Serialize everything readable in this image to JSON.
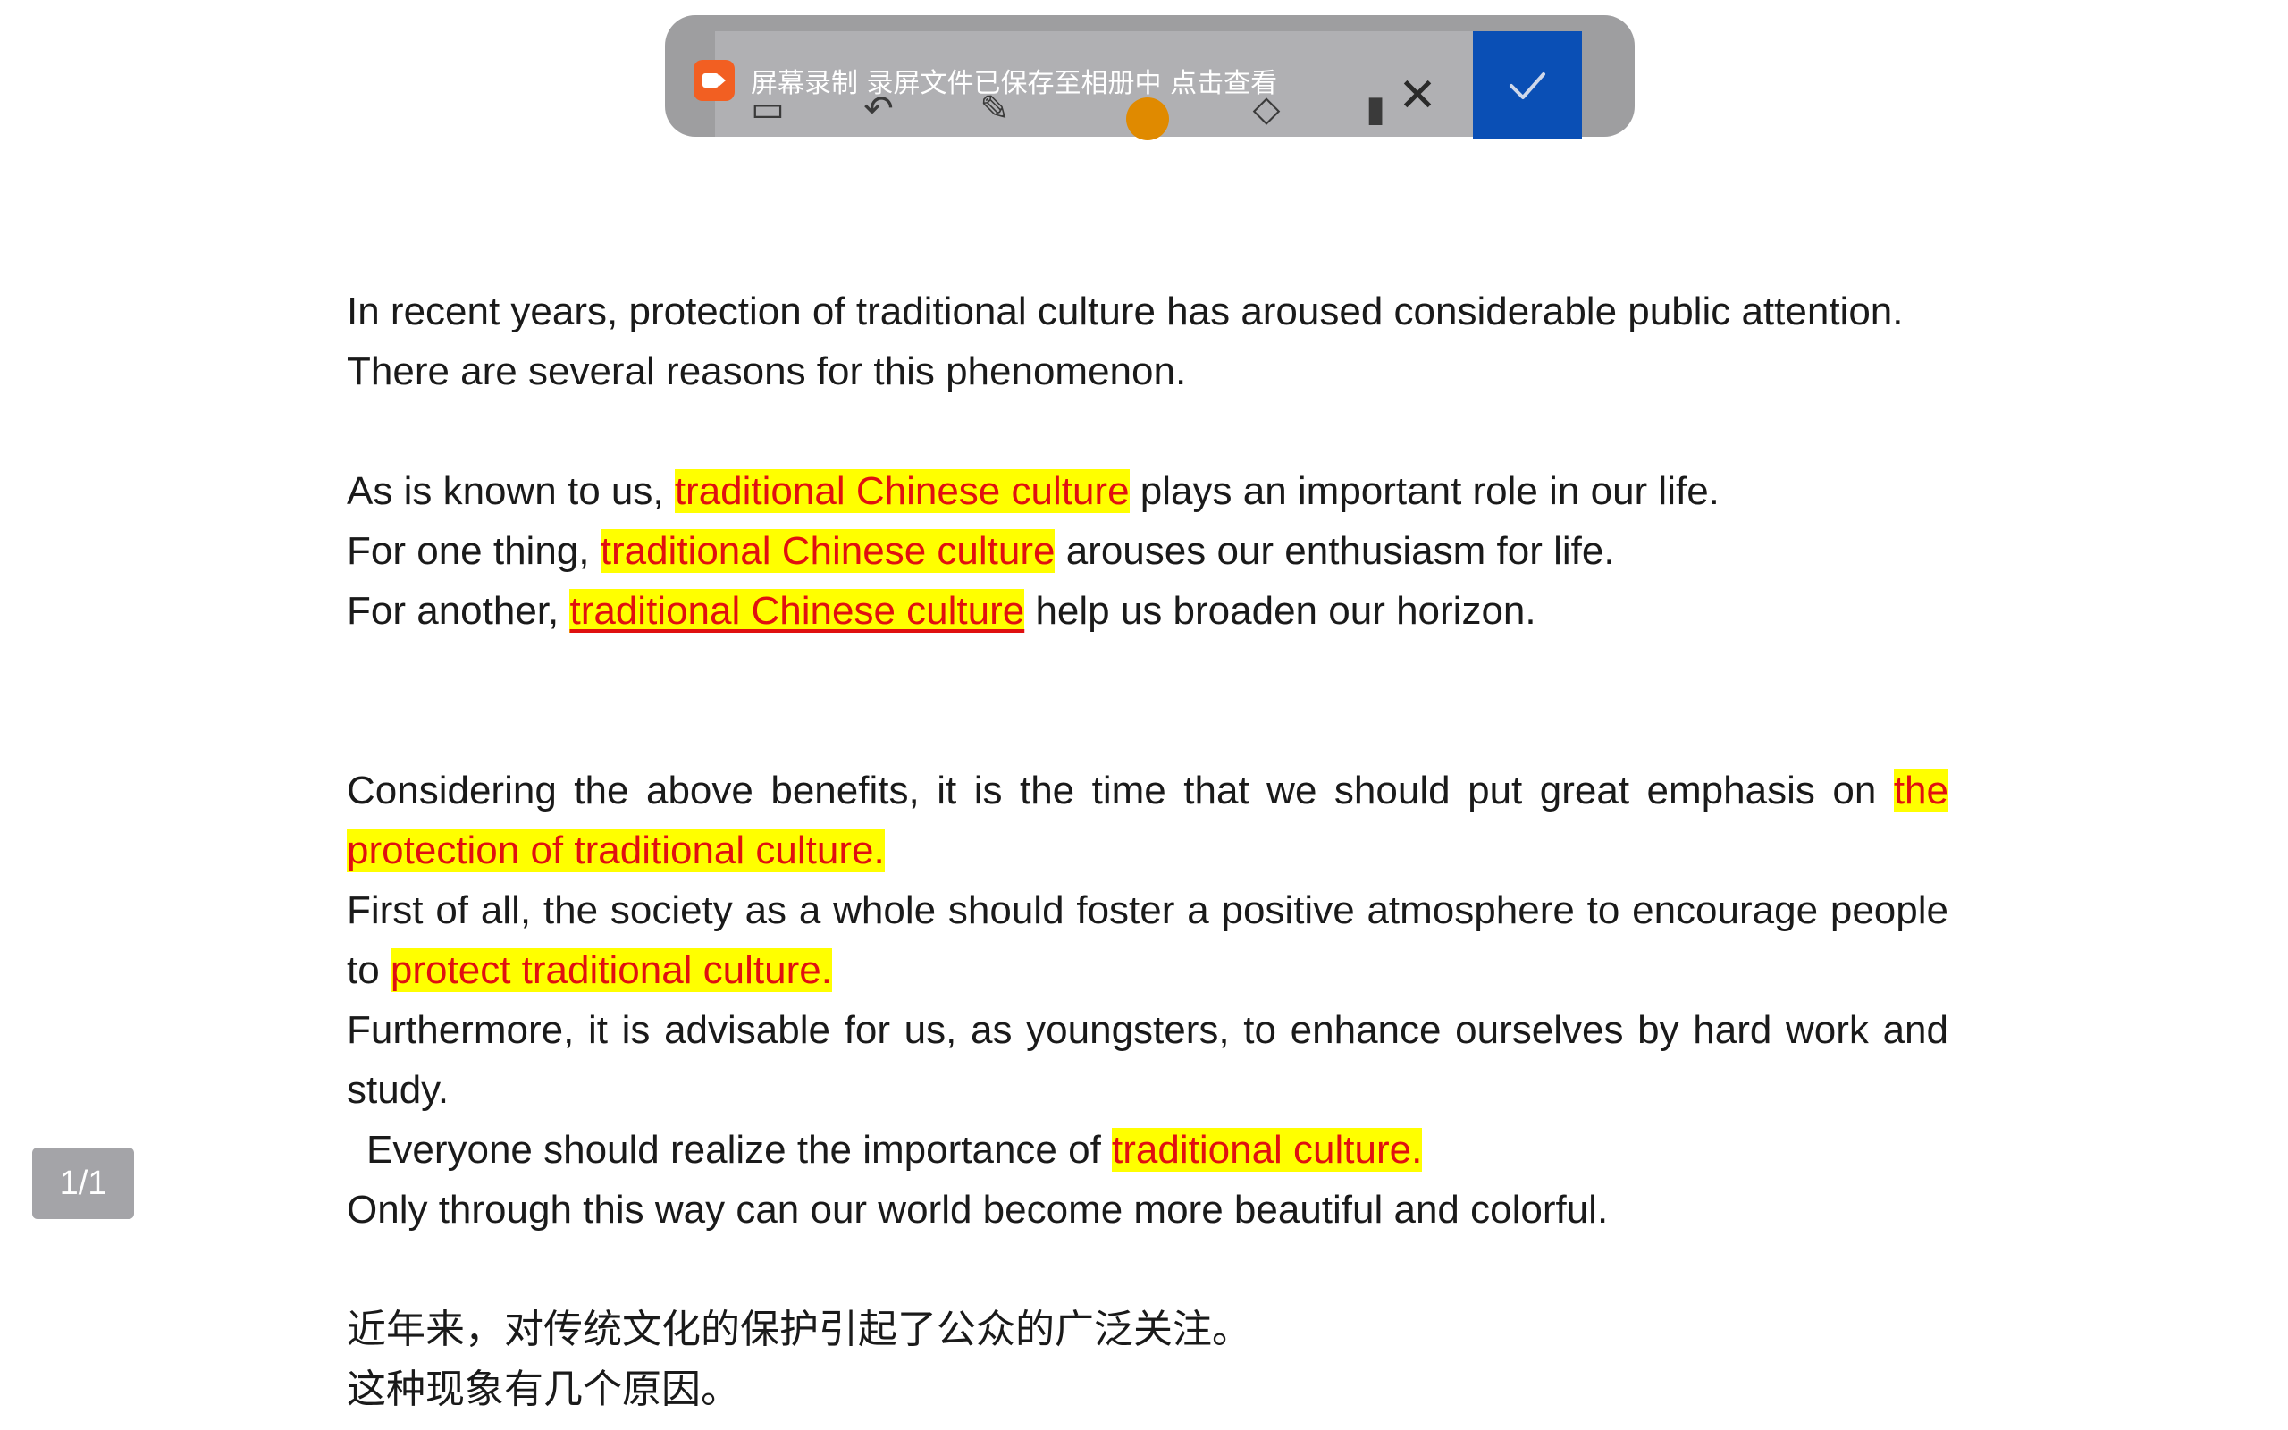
{
  "toolbar": {
    "notice_text": "屏幕录制  录屏文件已保存至相册中 点击查看",
    "icons": [
      "crop-icon",
      "undo-icon",
      "pen-icon",
      "color-dot-icon",
      "eraser-icon",
      "trash-icon",
      "close-icon",
      "check-icon"
    ],
    "confirm_color": "#0a4fb5",
    "highlight_color": "#ffff00",
    "highlight_text_color": "#e01010"
  },
  "document": {
    "p1": {
      "line1": "In recent years, protection of traditional culture has aroused considerable public attention.",
      "line2": "There are several reasons for this phenomenon."
    },
    "p2": {
      "l1_a": "As is known to us, ",
      "l1_hl": "traditional Chinese culture",
      "l1_b": " plays an important role in our life.",
      "l2_a": "For one thing, ",
      "l2_hl": "traditional Chinese culture",
      "l2_b": " arouses our enthusiasm for life.",
      "l3_a": "For another, ",
      "l3_hl": "traditional Chinese culture",
      "l3_b": " help us broaden our horizon."
    },
    "p3": {
      "s1_a": "Considering the above benefits, it is the time that we should put great emphasis on ",
      "s1_hl": "the protection of traditional culture.",
      "s2_a": "First of all, the society as a whole should foster a positive atmosphere to encourage people to ",
      "s2_hl": "protect traditional culture.",
      "s3": "Furthermore, it is advisable for us, as youngsters, to enhance ourselves by hard work and study.",
      "s4_a": "Everyone should realize the importance of ",
      "s4_hl": "traditional culture.",
      "s5": "Only through this way can our world become more beautiful and colorful."
    },
    "cn": {
      "line1": "近年来，对传统文化的保护引起了公众的广泛关注。",
      "line2": "这种现象有几个原因。"
    }
  },
  "page_indicator": "1/1"
}
